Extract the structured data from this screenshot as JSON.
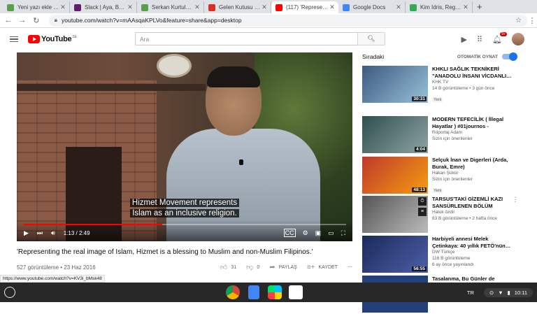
{
  "browser": {
    "tabs": [
      {
        "title": "Yeni yazı ekle ‹ TR…",
        "color": "#5b9e4d",
        "active": false
      },
      {
        "title": "Slack | Aya, Bülent…",
        "color": "#611f69",
        "active": false
      },
      {
        "title": "Serkan Kurtuluş: R…",
        "color": "#5b9e4d",
        "active": false
      },
      {
        "title": "Gelen Kutusu (6.4…",
        "color": "#d93025",
        "active": false
      },
      {
        "title": "(117) 'Representin…",
        "color": "#ff0000",
        "active": true
      },
      {
        "title": "Google Docs",
        "color": "#4285f4",
        "active": false
      },
      {
        "title": "Kim Idris, Regional…",
        "color": "#34a853",
        "active": false
      }
    ],
    "new_tab": "+",
    "url": "youtube.com/watch?v=mAAsqaKPLVo&feature=share&app=desktop",
    "status_url": "https://www.youtube.com/watch?v=KV3i_bMsk48"
  },
  "header": {
    "logo": "YouTube",
    "region": "SE",
    "search_placeholder": "Ara",
    "notification_count": "9+"
  },
  "player": {
    "caption_line1": "Hizmet Movement represents",
    "caption_line2": "Islam as an inclusive religion.",
    "time": "1:13 / 2:49",
    "progress": 0.43
  },
  "video": {
    "title": "'Representing the real image of Islam, Hizmet is a blessing to Muslim and non-Muslim Filipinos.'",
    "views": "527 görüntüleme • 23 Haz 2016",
    "likes": "31",
    "dislikes": "0",
    "share": "PAYLAŞ",
    "save": "KAYDET"
  },
  "sidebar": {
    "label": "Sıradaki",
    "autoplay": "OTOMATİK OYNAT",
    "items": [
      {
        "title": "KHKLI SAĞLIK TEKNİKERİ \"ANADOLU İNSANI VİCDANLI…",
        "channel": "KHK TV",
        "meta": "14 B görüntüleme • 3 gün önce",
        "badge": "Yeni",
        "duration": "30:31",
        "thumb": "#3d5a80"
      },
      {
        "title": "MODERN TEFECİLİK ( İllegal Hayatlar ) #01journos - Röport…",
        "channel": "Röportaj Adam",
        "meta": "Sizin için önerilenler",
        "badge": "",
        "duration": "4:04",
        "thumb": "#2f4f4f",
        "thumb_text": "TEFECİLİK"
      },
      {
        "title": "Selçuk İnan ve Digerleri (Arda, Burak, Emre)",
        "channel": "Hakan Şükür",
        "meta": "Sizin için önerilenler",
        "badge": "Yeni",
        "duration": "48:13",
        "thumb": "#c0392b"
      },
      {
        "title": "TARSUS'TAKİ GİZEMLİ KAZI SANSÜRLENEN BÖLÜM",
        "channel": "Haluk özdil",
        "meta": "83 B görüntüleme • 2 hafta önce",
        "badge": "",
        "duration": "",
        "thumb": "#7b7b7b"
      },
      {
        "title": "Harbiyeli annesi Melek Çetinkaya: 40 yıllık FETÖ'nün…",
        "channel": "DW Türkçe",
        "meta": "116 B görüntüleme",
        "meta2": "6 ay önce yayınlandı",
        "badge": "",
        "duration": "56:55",
        "thumb": "#1b2a5a",
        "thumb_text": "\"Komutana\" beraat, oğluma müebbet\""
      },
      {
        "title": "Tasalanma, Bu Günler de",
        "channel": "",
        "meta": "",
        "badge": "",
        "duration": "",
        "thumb": "#23407a"
      }
    ]
  },
  "shelf": {
    "lang": "TR",
    "time": "10:11"
  }
}
